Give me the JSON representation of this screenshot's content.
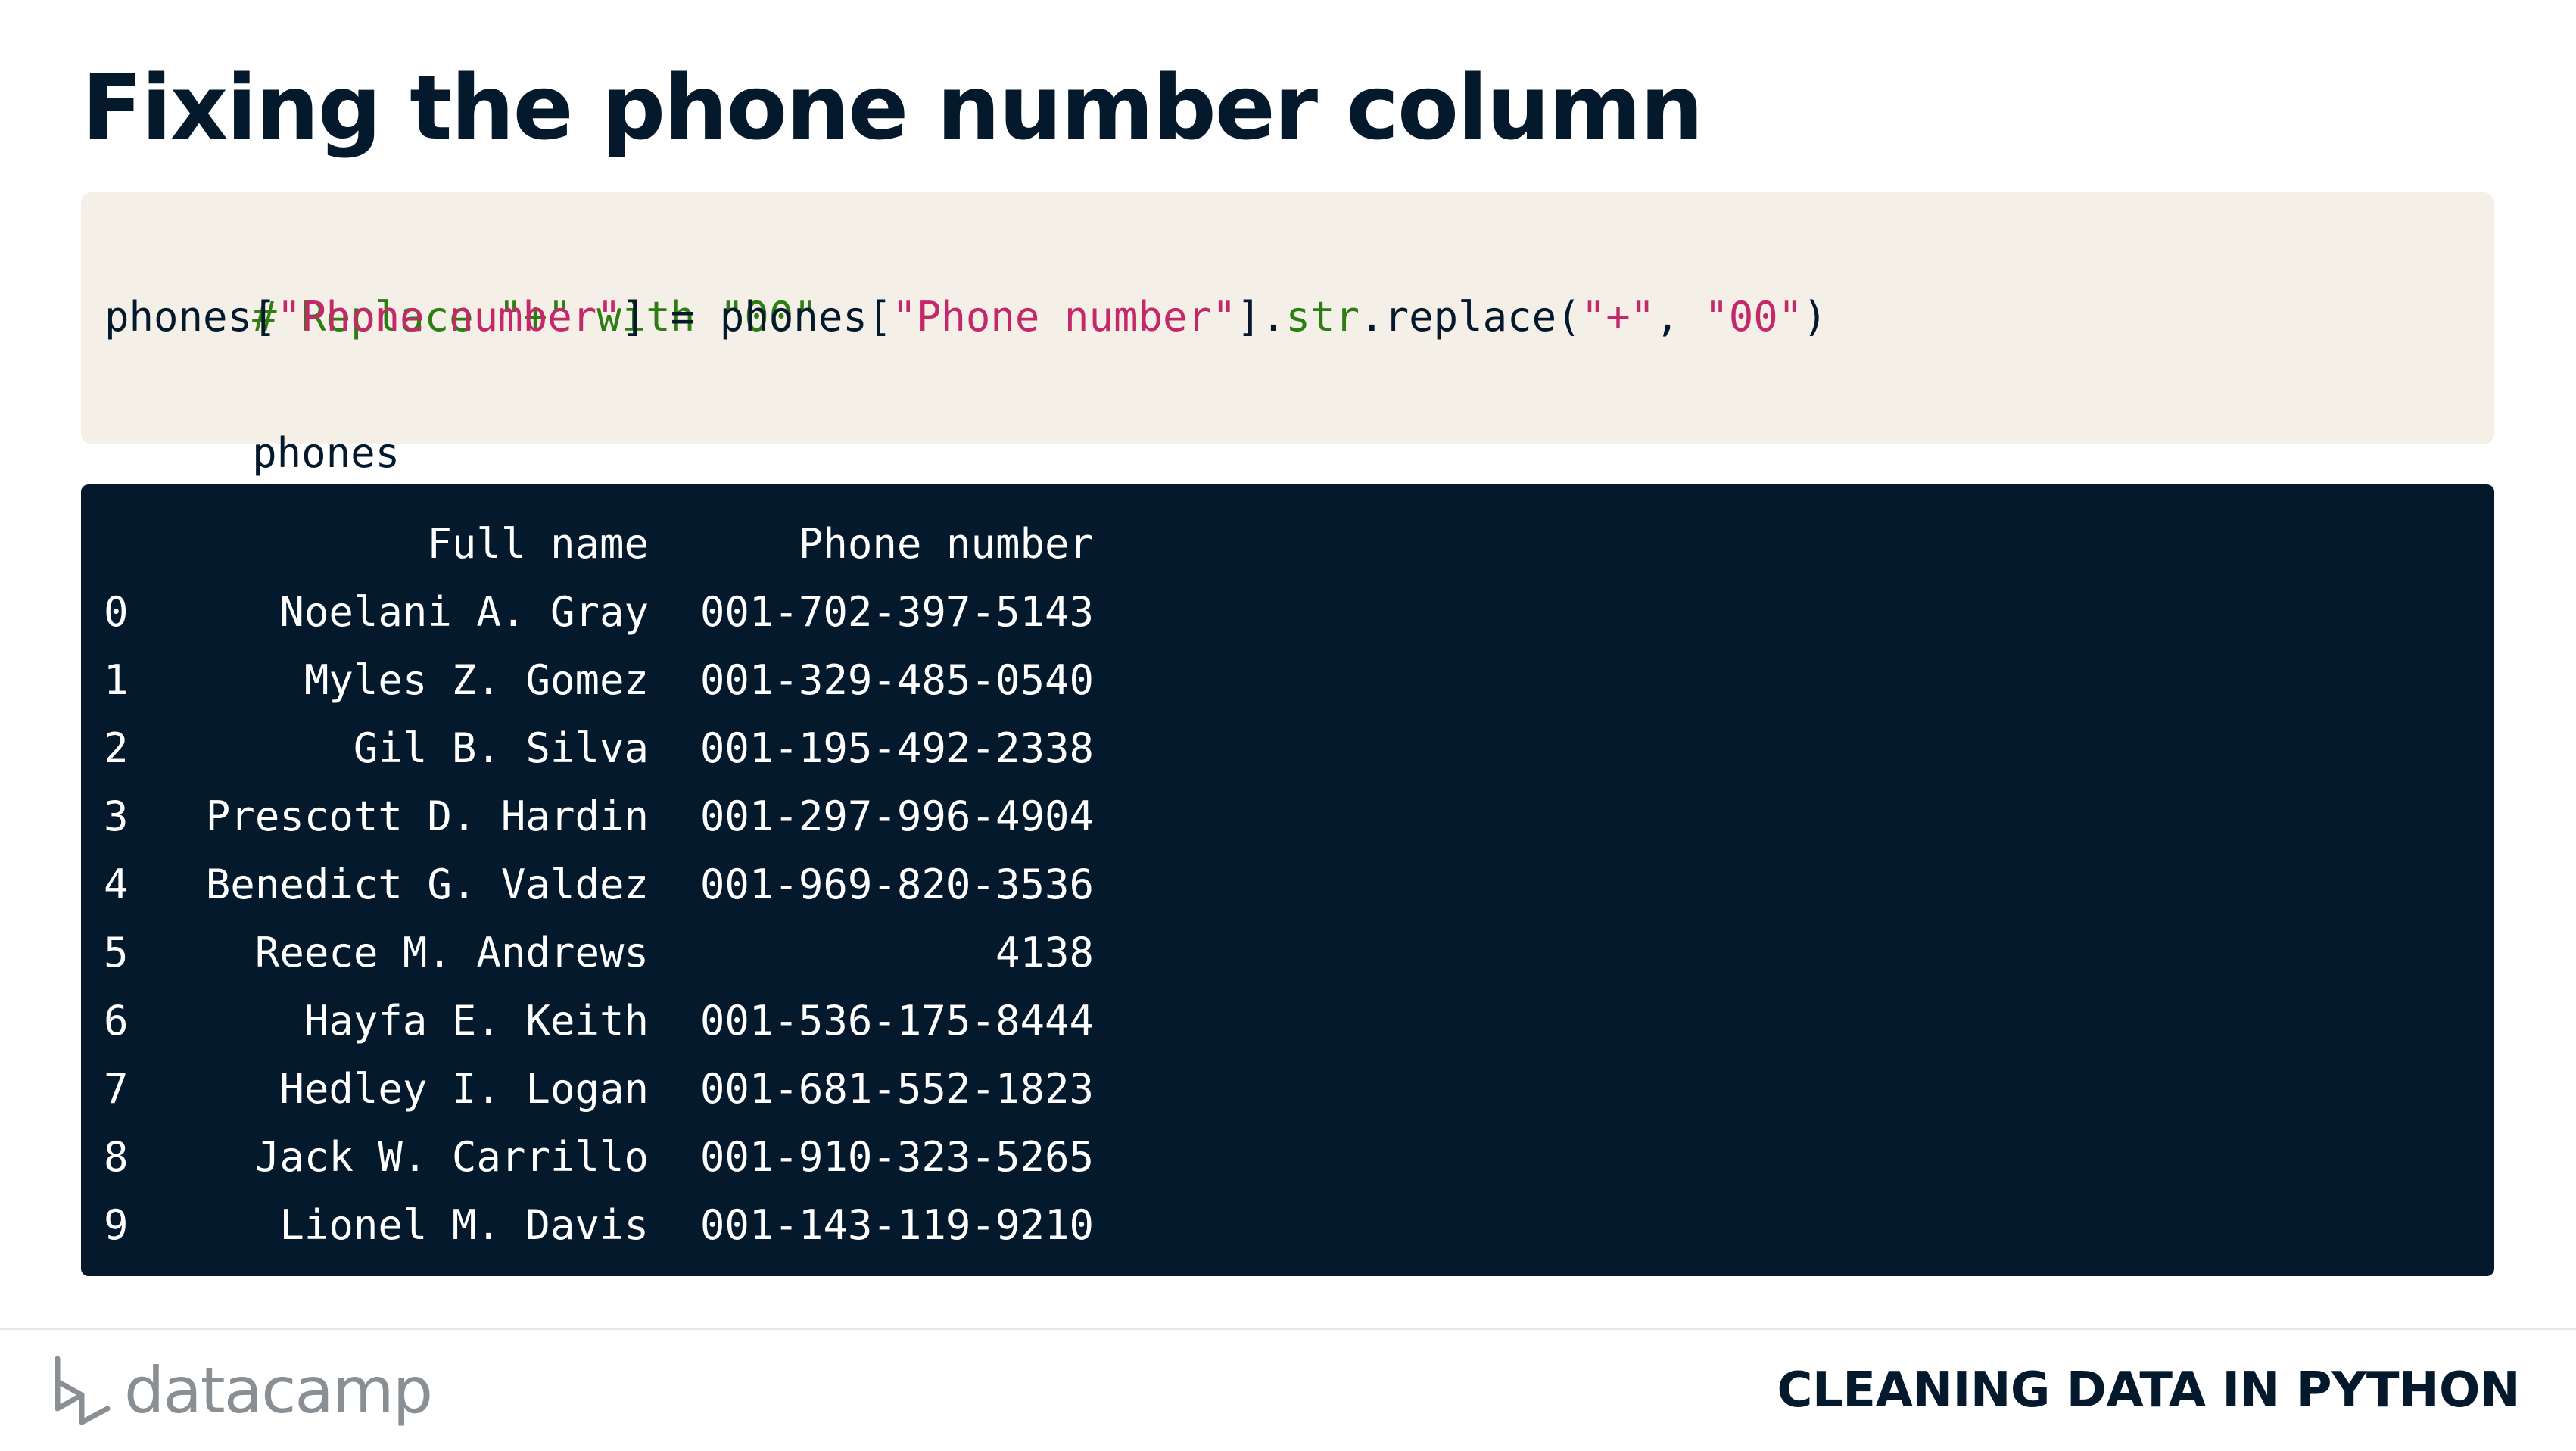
{
  "slide": {
    "title": "Fixing the phone number column"
  },
  "code": {
    "comment": "# Replace \"+\" with \"00\"",
    "line2": {
      "var1": "phones[",
      "key1": "\"Phone number\"",
      "mid": "] = phones[",
      "key2": "\"Phone number\"",
      "close": "].",
      "attr": "str",
      "method": ".replace(",
      "arg1": "\"+\"",
      "sep": ", ",
      "arg2": "\"00\"",
      "end": ")"
    },
    "line3": "phones"
  },
  "output": {
    "header": {
      "index": "",
      "full_name": "Full name",
      "phone_number": "Phone number"
    },
    "rows": [
      {
        "index": "0",
        "full_name": "Noelani A. Gray",
        "phone_number": "001-702-397-5143"
      },
      {
        "index": "1",
        "full_name": "Myles Z. Gomez",
        "phone_number": "001-329-485-0540"
      },
      {
        "index": "2",
        "full_name": "Gil B. Silva",
        "phone_number": "001-195-492-2338"
      },
      {
        "index": "3",
        "full_name": "Prescott D. Hardin",
        "phone_number": "001-297-996-4904"
      },
      {
        "index": "4",
        "full_name": "Benedict G. Valdez",
        "phone_number": "001-969-820-3536"
      },
      {
        "index": "5",
        "full_name": "Reece M. Andrews",
        "phone_number": "4138"
      },
      {
        "index": "6",
        "full_name": "Hayfa E. Keith",
        "phone_number": "001-536-175-8444"
      },
      {
        "index": "7",
        "full_name": "Hedley I. Logan",
        "phone_number": "001-681-552-1823"
      },
      {
        "index": "8",
        "full_name": "Jack W. Carrillo",
        "phone_number": "001-910-323-5265"
      },
      {
        "index": "9",
        "full_name": "Lionel M. Davis",
        "phone_number": "001-143-119-9210"
      }
    ]
  },
  "footer": {
    "logo_text": "datacamp",
    "logo_icon": "datacamp-logo-icon",
    "course_title": "CLEANING DATA IN PYTHON"
  },
  "colors": {
    "navy": "#05192d",
    "code_bg": "#f4f0e8",
    "comment_green": "#2e7d12",
    "string_pink": "#c4286a",
    "logo_grey": "#8a8f94"
  }
}
